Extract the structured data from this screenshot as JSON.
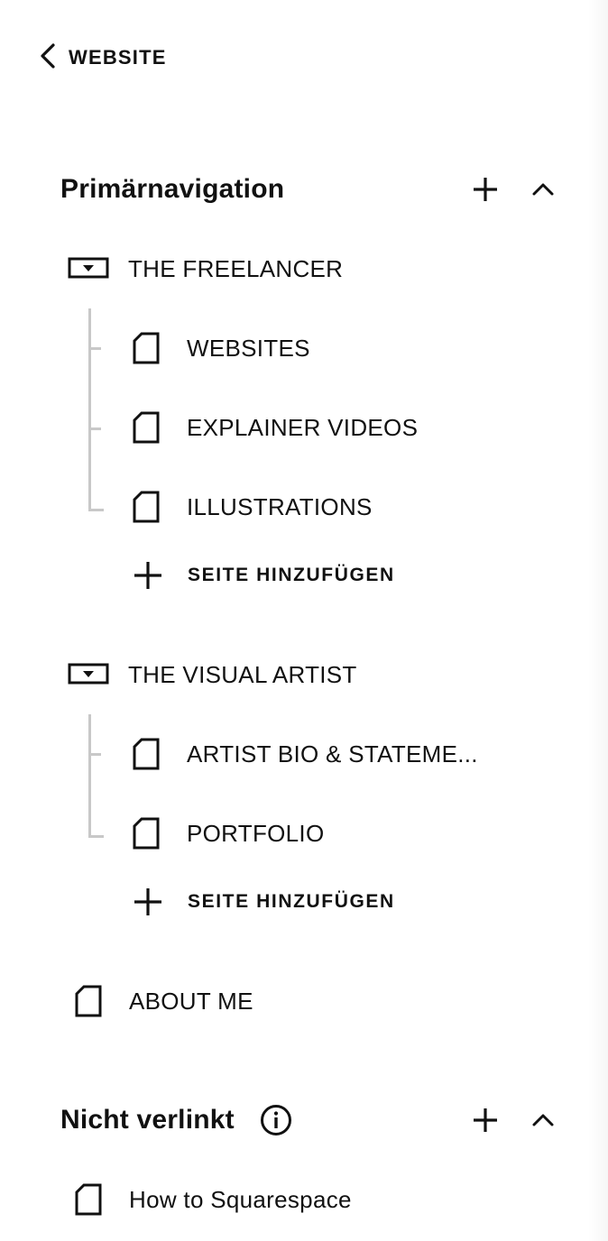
{
  "header": {
    "back_label": "WEBSITE"
  },
  "primary": {
    "title": "Primärnavigation",
    "folders": [
      {
        "label": "THE FREELANCER",
        "pages": [
          "WEBSITES",
          "EXPLAINER VIDEOS",
          "ILLUSTRATIONS"
        ],
        "add_label": "SEITE HINZUFÜGEN"
      },
      {
        "label": "THE VISUAL ARTIST",
        "pages": [
          "ARTIST BIO & STATEME...",
          "PORTFOLIO"
        ],
        "add_label": "SEITE HINZUFÜGEN"
      }
    ],
    "pages": [
      "ABOUT ME"
    ]
  },
  "unlinked": {
    "title": "Nicht verlinkt",
    "pages": [
      "How to Squarespace"
    ]
  }
}
